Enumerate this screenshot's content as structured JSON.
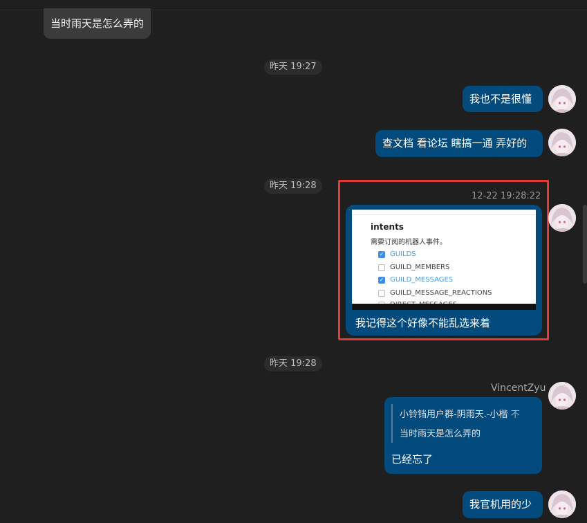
{
  "messages": {
    "incoming_partial": "当时雨天是怎么弄的",
    "time1": "昨天 19:27",
    "out1": "我也不是很懂",
    "out2": "查文档 看论坛 瞎搞一通 弄好的",
    "time2": "昨天 19:28",
    "image_msg": {
      "timestamp": "12-22 19:28:22",
      "caption": "我记得这个好像不能乱选来着",
      "screenshot": {
        "title": "intents",
        "subtitle": "需要订阅的机器人事件。",
        "options": [
          {
            "label": "GUILDS",
            "checked": true
          },
          {
            "label": "GUILD_MEMBERS",
            "checked": false
          },
          {
            "label": "GUILD_MESSAGES",
            "checked": true
          },
          {
            "label": "GUILD_MESSAGE_REACTIONS",
            "checked": false
          },
          {
            "label": "DIRECT_MESSAGES",
            "checked": false
          }
        ]
      }
    },
    "time3": "昨天 19:28",
    "reply_msg": {
      "sender": "VincentZyu",
      "quote_source": "小铃铛用户群-阴雨天.-小楷",
      "quote_more": "不",
      "quote_text": "当时雨天是怎么弄的",
      "text": "已经忘了"
    },
    "out_last": "我官机用的少"
  },
  "colors": {
    "background": "#1f1f1f",
    "outgoing_bubble": "#034a7d",
    "incoming_bubble": "#3b3b3b",
    "highlight": "#e53935",
    "checkbox": "#3b8ee8"
  },
  "icons": {
    "avatar": "anime-avatar-icon",
    "checkbox": "checkbox-icon"
  }
}
